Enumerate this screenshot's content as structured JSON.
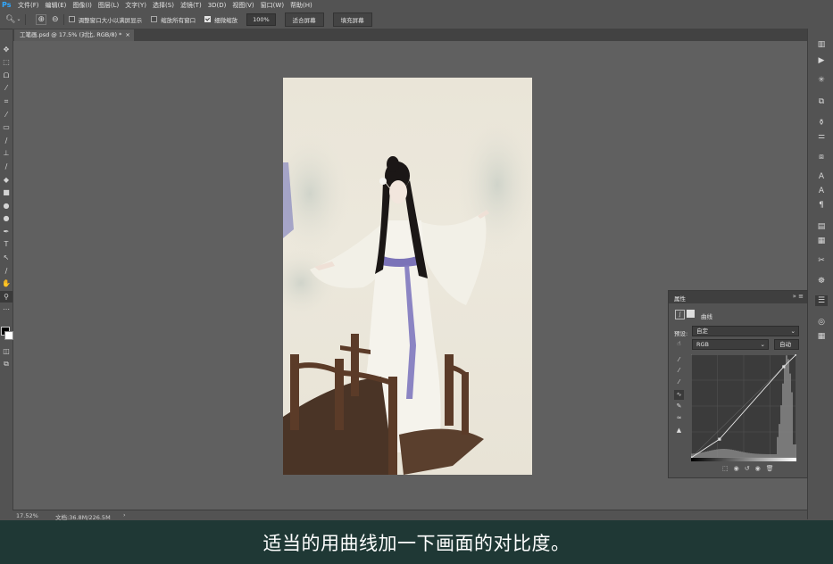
{
  "menubar": {
    "logo": "Ps",
    "items": [
      "文件(F)",
      "编辑(E)",
      "图像(I)",
      "图层(L)",
      "文字(Y)",
      "选择(S)",
      "滤镜(T)",
      "3D(D)",
      "视图(V)",
      "窗口(W)",
      "帮助(H)"
    ]
  },
  "options": {
    "resize_windows": "调整窗口大小以满屏显示",
    "zoom_all": "缩放所有窗口",
    "scrubby_zoom": "细微缩放",
    "zoom_value": "100%",
    "fit_screen": "适合屏幕",
    "fill_screen": "填充屏幕"
  },
  "document": {
    "tab_title": "工笔画.psd @ 17.5% (对比, RGB/8) *",
    "close": "×"
  },
  "status": {
    "zoom": "17.52%",
    "doc_info": "文档:36.8M/226.5M",
    "arrow": "›"
  },
  "properties": {
    "title": "属性",
    "menu": "»  ≡",
    "adjustment": "曲线",
    "preset_label": "预设:",
    "preset_value": "自定",
    "channel": "RGB",
    "auto": "自动"
  },
  "curve": {
    "points": [
      [
        0,
        0
      ],
      [
        0.27,
        0.18
      ],
      [
        0.88,
        0.88
      ],
      [
        1,
        1
      ]
    ],
    "histogram_color": "#8a8a8a"
  },
  "subtitle": "适当的用曲线加一下画面的对比度。",
  "colors": {
    "accent": "#31a8ff",
    "subtitle_bar": "#1f3835"
  }
}
